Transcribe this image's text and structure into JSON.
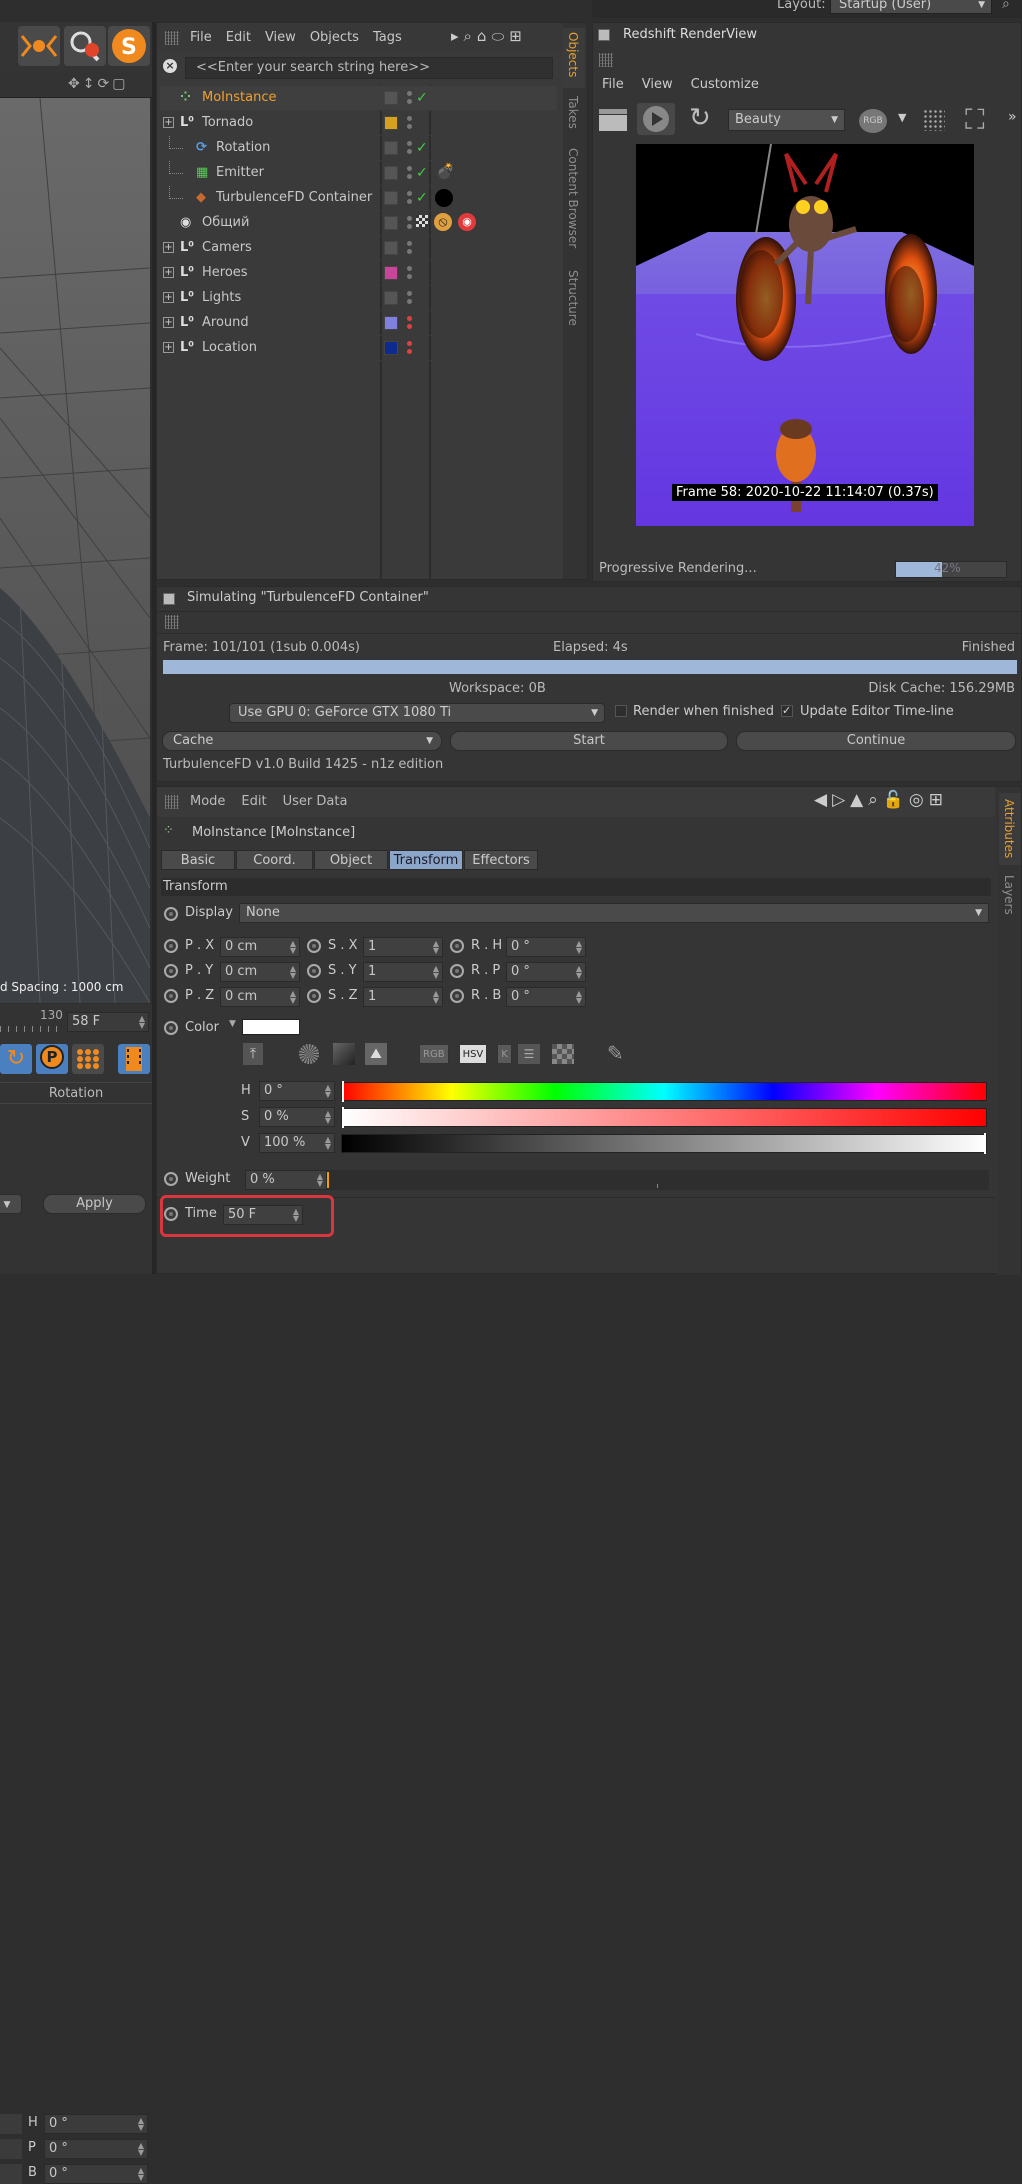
{
  "top": {
    "layout_label": "Layout:",
    "layout_value": "Startup (User)"
  },
  "objects": {
    "menu": [
      "File",
      "Edit",
      "View",
      "Objects",
      "Tags"
    ],
    "search_placeholder": "<<Enter your search string here>>",
    "rows": [
      {
        "name": "MoInstance",
        "selected": true
      },
      {
        "name": "Tornado"
      },
      {
        "name": "Rotation"
      },
      {
        "name": "Emitter"
      },
      {
        "name": "TurbulenceFD Container"
      },
      {
        "name": "Общий"
      },
      {
        "name": "Camers"
      },
      {
        "name": "Heroes"
      },
      {
        "name": "Lights"
      },
      {
        "name": "Around"
      },
      {
        "name": "Location"
      }
    ],
    "side_tabs": [
      "Objects",
      "Takes",
      "Content Browser",
      "Structure"
    ],
    "colors": {
      "tornado": "#d6a21e",
      "heroes": "#c8459a",
      "around": "#8080e0",
      "location": "#0d2a8c"
    }
  },
  "render": {
    "title": "Redshift RenderView",
    "menu": [
      "File",
      "View",
      "Customize"
    ],
    "aov": "Beauty",
    "rgb": "RGB",
    "frame_info": "Frame  58:  2020-10-22  11:14:07  (0.37s)",
    "status": "Progressive Rendering...",
    "progress_text": "42%",
    "progress_value": 0.42
  },
  "sim": {
    "title": "Simulating \"TurbulenceFD Container\"",
    "frame": "Frame: 101/101 (1sub 0.004s)",
    "elapsed": "Elapsed: 4s",
    "finished": "Finished",
    "progress_value": 1.0,
    "workspace": "Workspace: 0B",
    "disk_cache": "Disk Cache: 156.29MB",
    "gpu": "Use GPU 0: GeForce GTX 1080 Ti",
    "render_when_finished": "Render when finished",
    "update_editor": "Update Editor Time-line",
    "cache": "Cache",
    "start": "Start",
    "continue": "Continue",
    "build": "TurbulenceFD v1.0 Build 1425 - n1z edition"
  },
  "attributes": {
    "menu": [
      "Mode",
      "Edit",
      "User Data"
    ],
    "object_title": "MoInstance [MoInstance]",
    "tabs": [
      "Basic",
      "Coord.",
      "Object",
      "Transform",
      "Effectors"
    ],
    "active_tab": "Transform",
    "section": "Transform",
    "display_label": "Display",
    "display_value": "None",
    "pos": [
      {
        "label": "P . X",
        "value": "0 cm"
      },
      {
        "label": "P . Y",
        "value": "0 cm"
      },
      {
        "label": "P . Z",
        "value": "0 cm"
      }
    ],
    "scale": [
      {
        "label": "S . X",
        "value": "1"
      },
      {
        "label": "S . Y",
        "value": "1"
      },
      {
        "label": "S . Z",
        "value": "1"
      }
    ],
    "rot": [
      {
        "label": "R . H",
        "value": "0 °"
      },
      {
        "label": "R . P",
        "value": "0 °"
      },
      {
        "label": "R . B",
        "value": "0 °"
      }
    ],
    "color_label": "Color",
    "color_value": "#ffffff",
    "mode_buttons": [
      "RGB",
      "HSV",
      "K"
    ],
    "h_label": "H",
    "h_value": "0 °",
    "s_label": "S",
    "s_value": "0 %",
    "v_label": "V",
    "v_value": "100 %",
    "weight_label": "Weight",
    "weight_value": "0 %",
    "time_label": "Time",
    "time_value": "50 F",
    "side_tabs": [
      "Attributes",
      "Layers"
    ]
  },
  "viewport": {
    "spacing": "d Spacing : 1000 cm",
    "ruler_value": "130",
    "frame_field": "58 F",
    "rotation_label": "Rotation",
    "rot_fields": [
      {
        "label": "H",
        "value": "0 °"
      },
      {
        "label": "P",
        "value": "0 °"
      },
      {
        "label": "B",
        "value": "0 °"
      }
    ],
    "apply": "Apply"
  }
}
